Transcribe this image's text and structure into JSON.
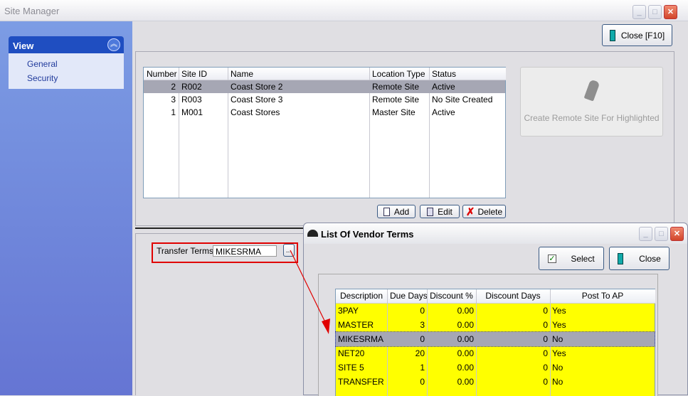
{
  "window": {
    "title": "Site Manager",
    "close_label": "Close [F10]"
  },
  "sidebar": {
    "section": "View",
    "items": [
      {
        "label": "General"
      },
      {
        "label": "Security"
      }
    ]
  },
  "sites": {
    "columns": [
      "Number",
      "Site ID",
      "Name",
      "Location Type",
      "Status"
    ],
    "rows": [
      [
        "2",
        "R002",
        "Coast Store 2",
        "Remote Site",
        "Active"
      ],
      [
        "3",
        "R003",
        "Coast Store 3",
        "Remote Site",
        "No Site Created"
      ],
      [
        "1",
        "M001",
        "Coast Stores",
        "Master Site",
        "Active"
      ]
    ],
    "selected_row": 0,
    "create_remote_label": "Create Remote Site For Highlighted",
    "add_label": "Add",
    "edit_label": "Edit",
    "delete_label": "Delete"
  },
  "transfer": {
    "label": "Transfer Terms:",
    "value": "MIKESRMA",
    "browse_label": "..."
  },
  "dialog": {
    "title": "List Of Vendor Terms",
    "select_label": "Select",
    "close_label": "Close",
    "columns": [
      "Description",
      "Due Days",
      "Discount %",
      "Discount Days",
      "Post To AP"
    ],
    "rows": [
      [
        "3PAY",
        "0",
        "0.00",
        "0",
        "Yes"
      ],
      [
        "MASTER",
        "3",
        "0.00",
        "0",
        "Yes"
      ],
      [
        "MIKESRMA",
        "0",
        "0.00",
        "0",
        "No"
      ],
      [
        "NET20",
        "20",
        "0.00",
        "0",
        "Yes"
      ],
      [
        "SITE 5",
        "1",
        "0.00",
        "0",
        "No"
      ],
      [
        "TRANSFER",
        "0",
        "0.00",
        "0",
        "No"
      ]
    ],
    "selected_row": 2
  },
  "colors": {
    "row_highlight": "#ffff00",
    "selected": "#a6a7b4",
    "annotation": "#e00000",
    "sidebar": "#6f88dc"
  }
}
